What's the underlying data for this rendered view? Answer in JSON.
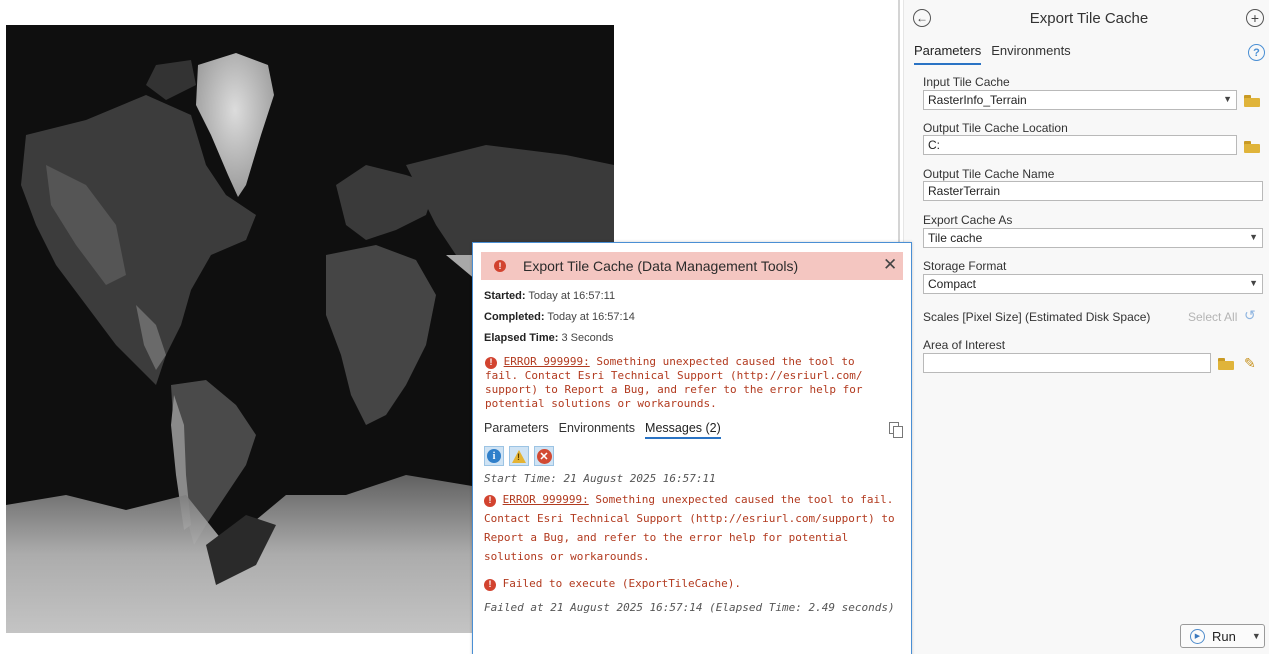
{
  "map": {
    "description_icon": "raster-world-terrain"
  },
  "gp_pane": {
    "title": "Export Tile Cache",
    "back_icon": "←",
    "add_icon": "+",
    "help_icon": "?",
    "tabs": [
      "Parameters",
      "Environments"
    ],
    "fields": {
      "input_tile_cache_label": "Input Tile Cache",
      "input_tile_cache_value": "RasterInfo_Terrain",
      "output_location_label": "Output Tile Cache Location",
      "output_location_value": "C:",
      "output_name_label": "Output Tile Cache Name",
      "output_name_value": "RasterTerrain",
      "export_as_label": "Export Cache As",
      "export_as_value": "Tile cache",
      "storage_format_label": "Storage Format",
      "storage_format_value": "Compact",
      "scales_label": "Scales [Pixel Size] (Estimated Disk Space)",
      "select_all": "Select All",
      "aoi_label": "Area of Interest",
      "aoi_value": ""
    },
    "run_label": "Run"
  },
  "popup": {
    "title": "Export Tile Cache (Data Management Tools)",
    "started_label": "Started:",
    "started_value": "Today at 16:57:11",
    "completed_label": "Completed:",
    "completed_value": "Today at 16:57:14",
    "elapsed_label": "Elapsed Time:",
    "elapsed_value": "3 Seconds",
    "error_code": "ERROR 999999:",
    "error_summary_lines": [
      "Something unexpected caused the tool to",
      "fail. Contact Esri Technical Support (http://esriurl.com/",
      "support) to Report a Bug, and refer to the error help for",
      "potential solutions or workarounds."
    ],
    "tabs": [
      "Parameters",
      "Environments",
      "Messages (2)"
    ],
    "messages": {
      "start_time": "Start Time: 21 August 2025 16:57:11",
      "error_code": "ERROR 999999:",
      "error_lines": [
        "Something unexpected caused the tool to fail.",
        "Contact Esri Technical Support (http://esriurl.com/support) to",
        "Report a Bug, and refer to the error help for potential",
        "solutions or workarounds."
      ],
      "failed_execute": "Failed to execute (ExportTileCache).",
      "failed_at": "Failed at 21 August 2025 16:57:14 (Elapsed Time: 2.49 seconds)"
    }
  }
}
